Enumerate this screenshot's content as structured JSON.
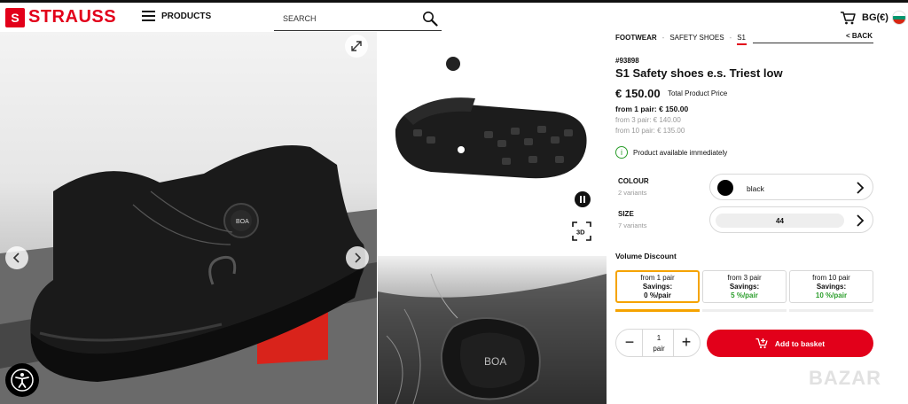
{
  "header": {
    "logo_mark": "S",
    "logo_text": "STRAUSS",
    "menu_label": "PRODUCTS",
    "search_placeholder": "SEARCH",
    "lang_label": "BG(€)",
    "flag_colors": [
      "#ffffff",
      "#00966e",
      "#d62612"
    ]
  },
  "gallery": {
    "boa_label_main": "BOA",
    "boa_label_detail": "BOA",
    "view3d_label": "3D"
  },
  "breadcrumb": {
    "items": [
      "FOOTWEAR",
      "SAFETY SHOES",
      "S1"
    ],
    "separator": "-",
    "back_label": "<  BACK"
  },
  "product": {
    "sku": "#93898",
    "title": "S1 Safety shoes e.s. Triest low",
    "price": "€ 150.00",
    "price_note": "Total Product Price",
    "tiers": [
      "from 1 pair: € 150.00",
      "from 3 pair: € 140.00",
      "from 10 pair: € 135.00"
    ],
    "availability": "Product available immediately",
    "availability_icon": "i"
  },
  "options": {
    "colour_label": "COLOUR",
    "colour_variants": "2 variants",
    "colour_value": "black",
    "size_label": "SIZE",
    "size_variants": "7 variants",
    "size_value": "44"
  },
  "volume": {
    "title": "Volume Discount",
    "tiers": [
      {
        "label": "from 1 pair",
        "savings_label": "Savings:",
        "savings": "0 %/pair"
      },
      {
        "label": "from 3 pair",
        "savings_label": "Savings:",
        "savings": "5 %/pair"
      },
      {
        "label": "from 10 pair",
        "savings_label": "Savings:",
        "savings": "10 %/pair"
      }
    ]
  },
  "cart": {
    "minus": "−",
    "plus": "+",
    "quantity": "1",
    "unit": "pair",
    "add_label": "Add to basket"
  },
  "watermark": "BAZAR",
  "colors": {
    "brand_red": "#e2001a",
    "selected_tier": "#f5a300",
    "available_green": "#2a9d2a"
  }
}
